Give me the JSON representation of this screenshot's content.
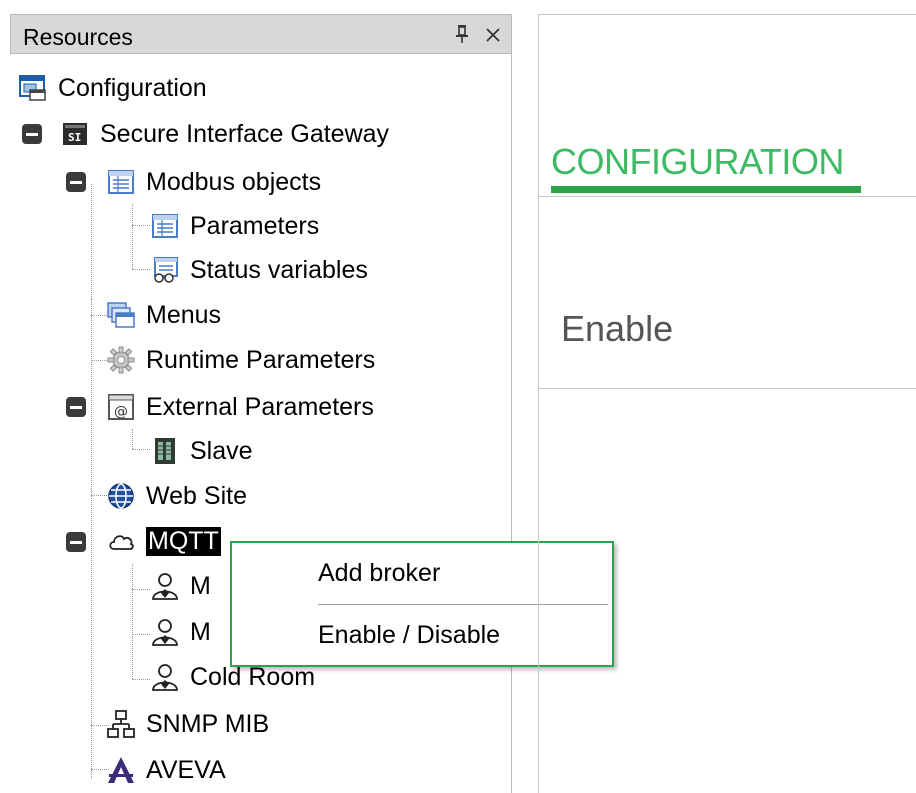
{
  "resources_panel": {
    "title": "Resources",
    "pin_glyph": "I",
    "close_glyph": "×"
  },
  "tree": {
    "configuration": "Configuration",
    "gateway": "Secure Interface Gateway",
    "modbus_objects": "Modbus objects",
    "parameters": "Parameters",
    "status_variables": "Status variables",
    "menus": "Menus",
    "runtime_parameters": "Runtime Parameters",
    "external_parameters": "External Parameters",
    "slave": "Slave",
    "web_site": "Web Site",
    "mqtt": "MQTT",
    "broker_1": "M",
    "broker_2": "M",
    "cold_room": "Cold Room",
    "snmp_mib": "SNMP MIB",
    "aveva": "AVEVA"
  },
  "context_menu": {
    "add_broker": "Add broker",
    "enable_disable": "Enable / Disable"
  },
  "detail": {
    "tab_label": "CONFIGURATION",
    "enable_label": "Enable"
  },
  "colors": {
    "accent_green": "#2aa34a",
    "tab_text_green": "#3dbb63"
  }
}
